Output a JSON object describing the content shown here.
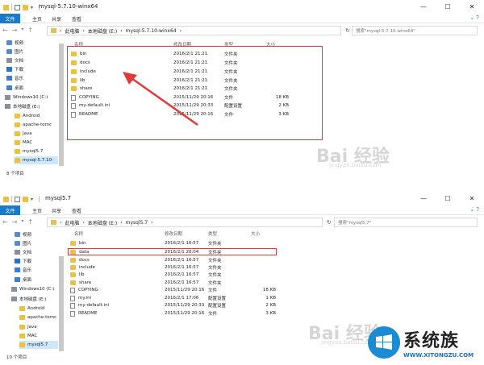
{
  "window1": {
    "title": "mysql-5.7.10-winx64",
    "ribbon": {
      "file": "文件",
      "home": "主页",
      "share": "共享",
      "view": "查看"
    },
    "breadcrumb": [
      "此电脑",
      "本地磁盘 (E:)",
      "mysql-5.7.10-winx64"
    ],
    "search_placeholder": "搜索\"mysql-5.7.10-winx64\"",
    "columns": {
      "name": "名称",
      "date": "修改日期",
      "type": "类型",
      "size": "大小"
    },
    "sidebar": [
      "视频",
      "图片",
      "文档",
      "下载",
      "音乐",
      "桌面",
      "Windows10 (C:)",
      "本地磁盘 (E:)",
      "Android",
      "apache-tomc",
      "Java",
      "MAC",
      "mysql5.7",
      "mysql-5.7.10-"
    ],
    "files": [
      {
        "name": "bin",
        "date": "2016/2/1 21:21",
        "type": "文件夹",
        "size": ""
      },
      {
        "name": "docs",
        "date": "2016/2/1 21:21",
        "type": "文件夹",
        "size": ""
      },
      {
        "name": "include",
        "date": "2016/2/1 21:21",
        "type": "文件夹",
        "size": ""
      },
      {
        "name": "lib",
        "date": "2016/2/1 21:21",
        "type": "文件夹",
        "size": ""
      },
      {
        "name": "share",
        "date": "2016/2/1 21:21",
        "type": "文件夹",
        "size": ""
      },
      {
        "name": "COPYING",
        "date": "2015/11/29 20:16",
        "type": "文件",
        "size": "18 KB"
      },
      {
        "name": "my-default.ini",
        "date": "2015/11/29 20:33",
        "type": "配置设置",
        "size": "2 KB"
      },
      {
        "name": "README",
        "date": "2015/11/29 20:16",
        "type": "文件",
        "size": "3 KB"
      }
    ],
    "status": "8 个项目"
  },
  "window2": {
    "title": "mysql5.7",
    "ribbon": {
      "file": "文件",
      "home": "主页",
      "share": "共享",
      "view": "查看"
    },
    "breadcrumb": [
      "此电脑",
      "本地磁盘 (E:)",
      "mysql5.7"
    ],
    "search_placeholder": "搜索\"mysql5.7\"",
    "columns": {
      "name": "名称",
      "date": "修改日期",
      "type": "类型",
      "size": "大小"
    },
    "sidebar": [
      "视频",
      "图片",
      "文档",
      "下载",
      "音乐",
      "桌面",
      "Windows10 (C:)",
      "本地磁盘 (E:)",
      "Android",
      "apache-tomc",
      "Java",
      "MAC",
      "mysql5.7"
    ],
    "files": [
      {
        "name": "bin",
        "date": "2016/2/1 16:57",
        "type": "文件夹",
        "size": ""
      },
      {
        "name": "data",
        "date": "2016/2/1 20:04",
        "type": "文件夹",
        "size": ""
      },
      {
        "name": "docs",
        "date": "2016/2/1 16:57",
        "type": "文件夹",
        "size": ""
      },
      {
        "name": "include",
        "date": "2016/2/1 16:57",
        "type": "文件夹",
        "size": ""
      },
      {
        "name": "lib",
        "date": "2016/2/1 16:57",
        "type": "文件夹",
        "size": ""
      },
      {
        "name": "share",
        "date": "2016/2/1 16:57",
        "type": "文件夹",
        "size": ""
      },
      {
        "name": "COPYING",
        "date": "2015/11/29 20:16",
        "type": "文件",
        "size": "18 KB"
      },
      {
        "name": "my.ini",
        "date": "2016/2/1 17:06",
        "type": "配置设置",
        "size": "1 KB"
      },
      {
        "name": "my-default.ini",
        "date": "2015/11/29 20:33",
        "type": "配置设置",
        "size": "2 KB"
      },
      {
        "name": "README",
        "date": "2015/11/29 20:16",
        "type": "文件",
        "size": "3 KB"
      }
    ],
    "status": "10 个项目"
  },
  "watermark": {
    "text": "Bai 经验",
    "url": "jingyan.baidu.com"
  },
  "logo": {
    "name": "系统族",
    "url": "WWW.XITONGZU.COM"
  },
  "colors": {
    "accent": "#1979ca",
    "highlight": "#e03b3b",
    "folder": "#e8c04a",
    "selected": "#cce8ff"
  }
}
